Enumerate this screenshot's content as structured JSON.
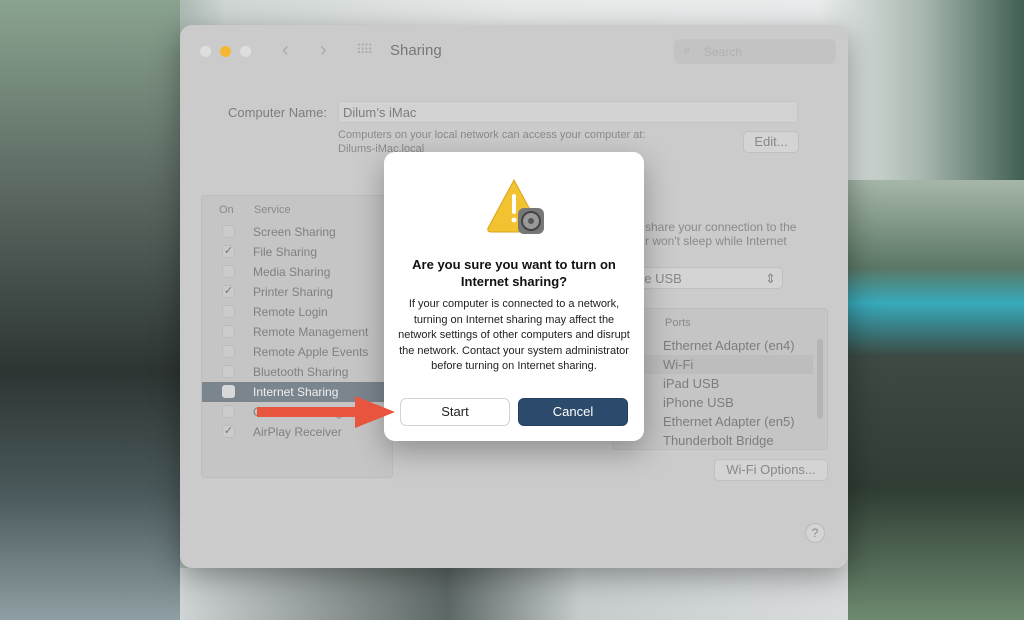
{
  "window": {
    "title": "Sharing",
    "search_placeholder": "Search"
  },
  "computer_name": {
    "label": "Computer Name:",
    "value": "Dilum’s iMac",
    "info": "Computers on your local network can access your computer at:",
    "address": "Dilums-iMac.local",
    "edit_label": "Edit..."
  },
  "services": {
    "col_on": "On",
    "col_service": "Service",
    "items": [
      {
        "label": "Screen Sharing",
        "on": false
      },
      {
        "label": "File Sharing",
        "on": true
      },
      {
        "label": "Media Sharing",
        "on": false
      },
      {
        "label": "Printer Sharing",
        "on": true
      },
      {
        "label": "Remote Login",
        "on": false
      },
      {
        "label": "Remote Management",
        "on": false
      },
      {
        "label": "Remote Apple Events",
        "on": false
      },
      {
        "label": "Bluetooth Sharing",
        "on": false
      },
      {
        "label": "Internet Sharing",
        "on": false,
        "selected": true
      },
      {
        "label": "Content Caching",
        "on": false
      },
      {
        "label": "AirPlay Receiver",
        "on": true
      }
    ]
  },
  "detail": {
    "desc_line1": "share your connection to the",
    "desc_line2": "r won't sleep while Internet",
    "share_from": "iPhone USB",
    "ports_header": "Ports",
    "ports": [
      "Ethernet Adapter (en4)",
      "Wi-Fi",
      "iPad USB",
      "iPhone USB",
      "Ethernet Adapter (en5)",
      "Thunderbolt Bridge"
    ],
    "selected_port": "Wi-Fi",
    "wifi_options": "Wi-Fi Options...",
    "help": "?"
  },
  "dialog": {
    "title": "Are you sure you want to turn on Internet sharing?",
    "message": "If your computer is connected to a network, turning on Internet sharing may affect the network settings of other computers and disrupt the network. Contact your system administrator before turning on Internet sharing.",
    "start": "Start",
    "cancel": "Cancel"
  },
  "colors": {
    "accent": "#2c4a6b",
    "arrow": "#e8553f",
    "traffic_yellow": "#f5b731"
  }
}
